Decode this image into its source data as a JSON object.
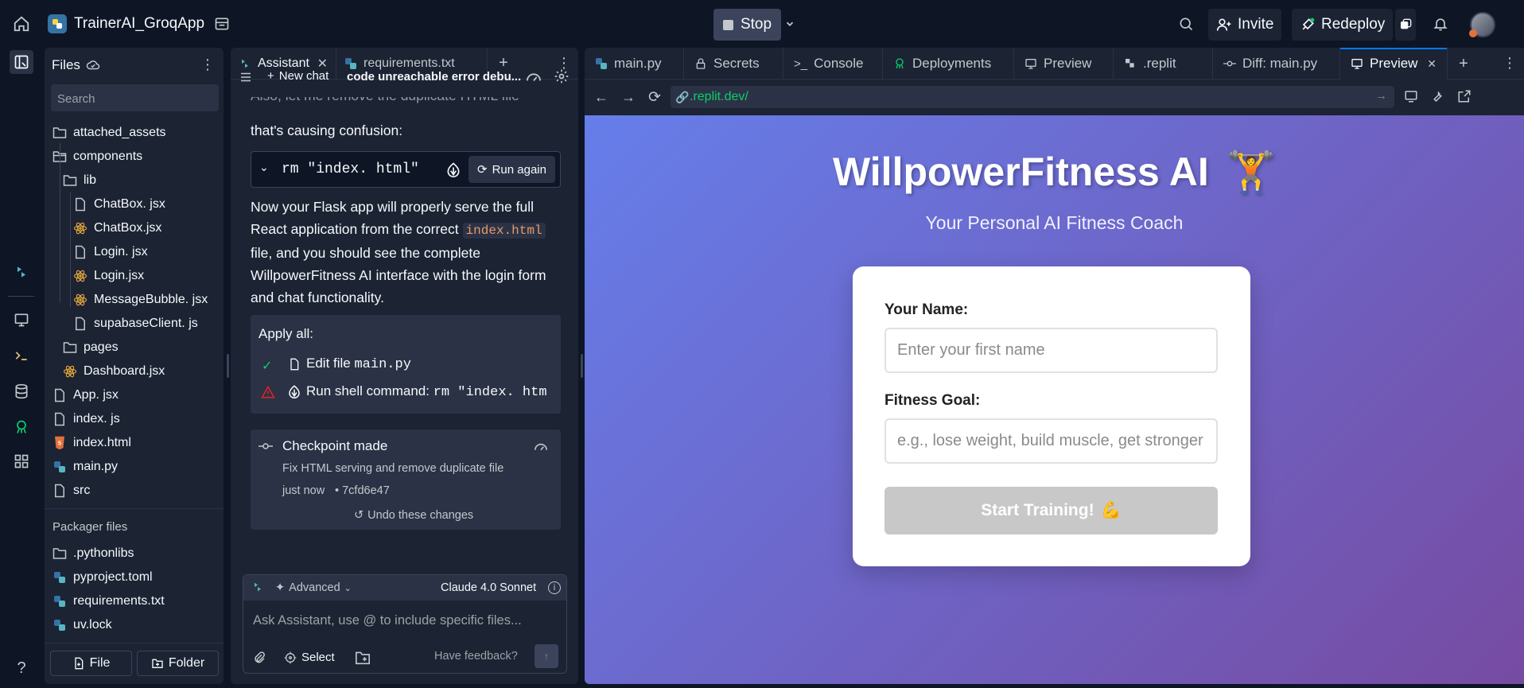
{
  "topbar": {
    "app_name": "TrainerAI_GroqApp",
    "stop_label": "Stop",
    "invite_label": "Invite",
    "redeploy_label": "Redeploy"
  },
  "files": {
    "title": "Files",
    "search_placeholder": "Search",
    "items": [
      "attached_assets",
      "components",
      "lib",
      "ChatBox. jsx",
      "ChatBox.jsx",
      "Login. jsx",
      "Login.jsx",
      "MessageBubble. jsx",
      "supabaseClient. js",
      "pages",
      "Dashboard.jsx",
      "App. jsx",
      "index. js",
      "index.html",
      "main.py",
      "src"
    ],
    "packager_label": "Packager files",
    "packager_items": [
      ".pythonlibs",
      "pyproject.toml",
      "requirements.txt",
      "uv.lock"
    ],
    "file_button": "File",
    "folder_button": "Folder"
  },
  "assistant": {
    "tabs": [
      "Assistant",
      "requirements.txt"
    ],
    "new_chat": "New chat",
    "chat_title": "code unreachable error debu...",
    "intro_cut": "Also, let me remove the duplicate HTML file",
    "intro_cont": "that's causing confusion:",
    "command": "rm \"index. html\"",
    "run_again": "Run again",
    "message_part1": "Now your Flask app will properly serve the full React application from the correct",
    "message_code": "index.html",
    "message_part2": "file, and you should see the complete WillpowerFitness AI interface with the login form and chat functionality.",
    "apply_all": "Apply all:",
    "action1_prefix": "Edit file",
    "action1_file": "main.py",
    "action2_prefix": "Run shell command:",
    "action2_cmd": "rm \"index. htm",
    "checkpoint_title": "Checkpoint made",
    "checkpoint_desc": "Fix HTML serving and remove duplicate file",
    "checkpoint_time": "just now",
    "checkpoint_hash": "• 7cfd6e47",
    "undo_label": "Undo these changes",
    "advanced_label": "Advanced",
    "model_label": "Claude 4.0 Sonnet",
    "input_placeholder": "Ask Assistant, use @ to include specific files...",
    "select_label": "Select",
    "feedback_label": "Have feedback?"
  },
  "workspace": {
    "tabs": [
      "main.py",
      "Secrets",
      "Console",
      "Deployments",
      "Preview",
      ".replit",
      "Diff: main.py",
      "Preview"
    ],
    "url": ".replit.dev/"
  },
  "preview": {
    "title": "WillpowerFitness AI",
    "title_emoji": "🏋️",
    "subtitle": "Your Personal AI Fitness Coach",
    "name_label": "Your Name:",
    "name_placeholder": "Enter your first name",
    "goal_label": "Fitness Goal:",
    "goal_placeholder": "e.g., lose weight, build muscle, get stronger",
    "start_label": "Start Training!",
    "start_emoji": "💪"
  }
}
